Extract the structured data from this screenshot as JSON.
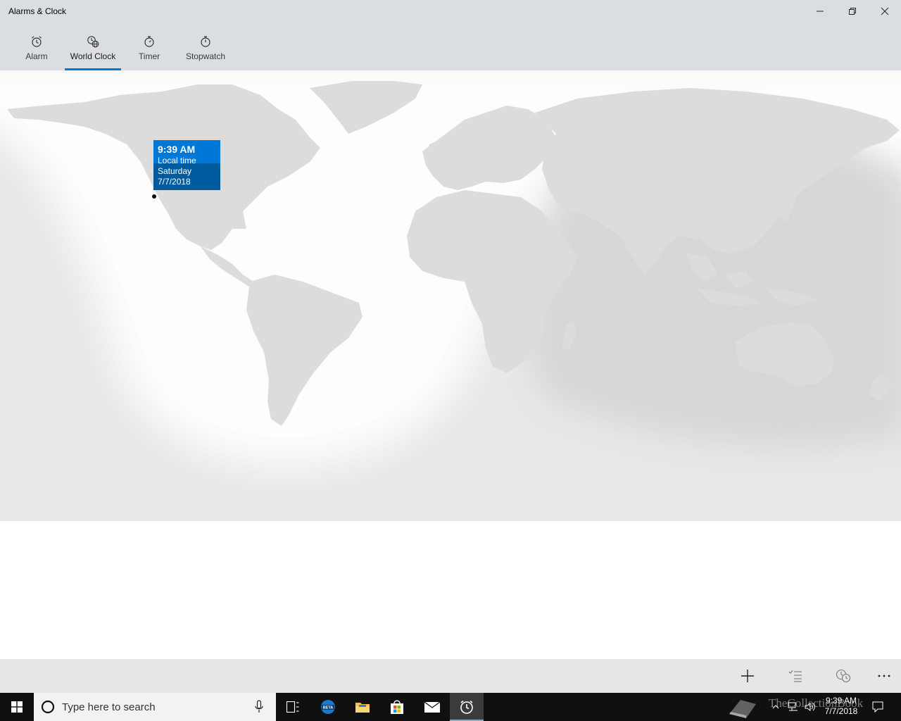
{
  "window": {
    "title": "Alarms & Clock"
  },
  "tabs": [
    {
      "label": "Alarm",
      "icon": "alarm-clock-icon"
    },
    {
      "label": "World Clock",
      "icon": "world-clock-icon",
      "selected": true
    },
    {
      "label": "Timer",
      "icon": "timer-icon"
    },
    {
      "label": "Stopwatch",
      "icon": "stopwatch-icon"
    }
  ],
  "map": {
    "popup": {
      "time": "9:39 AM",
      "subtitle": "Local time",
      "day": "Saturday",
      "date": "7/7/2018"
    }
  },
  "commandbar": {
    "buttons": [
      "add-icon",
      "select-icon",
      "compare-icon",
      "more-icon"
    ]
  },
  "taskbar": {
    "search_placeholder": "Type here to search",
    "apps": [
      "task-view-icon",
      "edge-beta-icon",
      "file-explorer-icon",
      "store-icon",
      "mail-icon",
      "alarms-clock-icon"
    ],
    "clock_time": "9:39 AM",
    "clock_date": "7/7/2018",
    "watermark": "TheCollectionBook"
  },
  "colors": {
    "accent": "#0078d7",
    "accent_dark": "#005a9e",
    "chrome": "#dadde2",
    "taskbar": "#101010"
  }
}
